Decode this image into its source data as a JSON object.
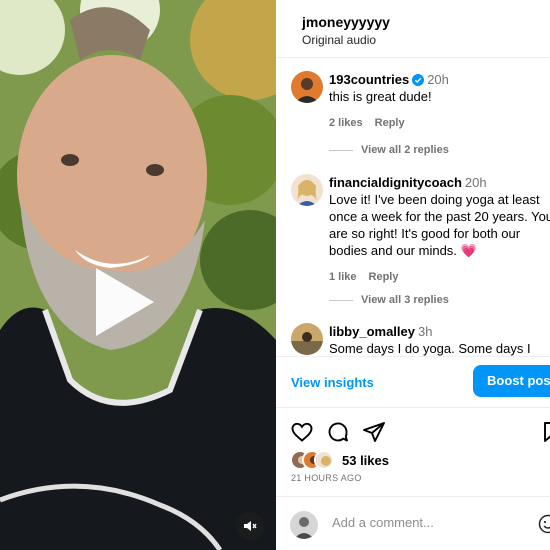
{
  "post": {
    "author": "jmoneyyyyyy",
    "audio": "Original audio"
  },
  "comments": [
    {
      "user": "193countries",
      "verified": true,
      "time": "20h",
      "text": "this is great dude!",
      "likes": "2 likes",
      "reply": "Reply",
      "view_replies": "View all 2 replies"
    },
    {
      "user": "financialdignitycoach",
      "verified": false,
      "time": "20h",
      "text": "Love it! I've been doing yoga at least once a week for the past 20 years. You are so right! It's good for both our bodies and our minds. 💗",
      "likes": "1 like",
      "reply": "Reply",
      "view_replies": "View all 3 replies"
    },
    {
      "user": "libby_omalley",
      "verified": false,
      "time": "3h",
      "text": "Some days I do yoga. Some days I"
    }
  ],
  "insights": {
    "view_insights": "View insights",
    "boost": "Boost post"
  },
  "engagement": {
    "likes": "53 likes",
    "posted": "21 HOURS AGO"
  },
  "add_comment": {
    "placeholder": "Add a comment..."
  },
  "icons": [
    "play-icon",
    "mute-icon",
    "verified-icon",
    "heart-icon",
    "comment-icon",
    "share-icon",
    "bookmark-icon",
    "emoji-icon"
  ],
  "colors": {
    "accent": "#0095f6",
    "muted": "#737373",
    "verified": "#0095f6"
  }
}
